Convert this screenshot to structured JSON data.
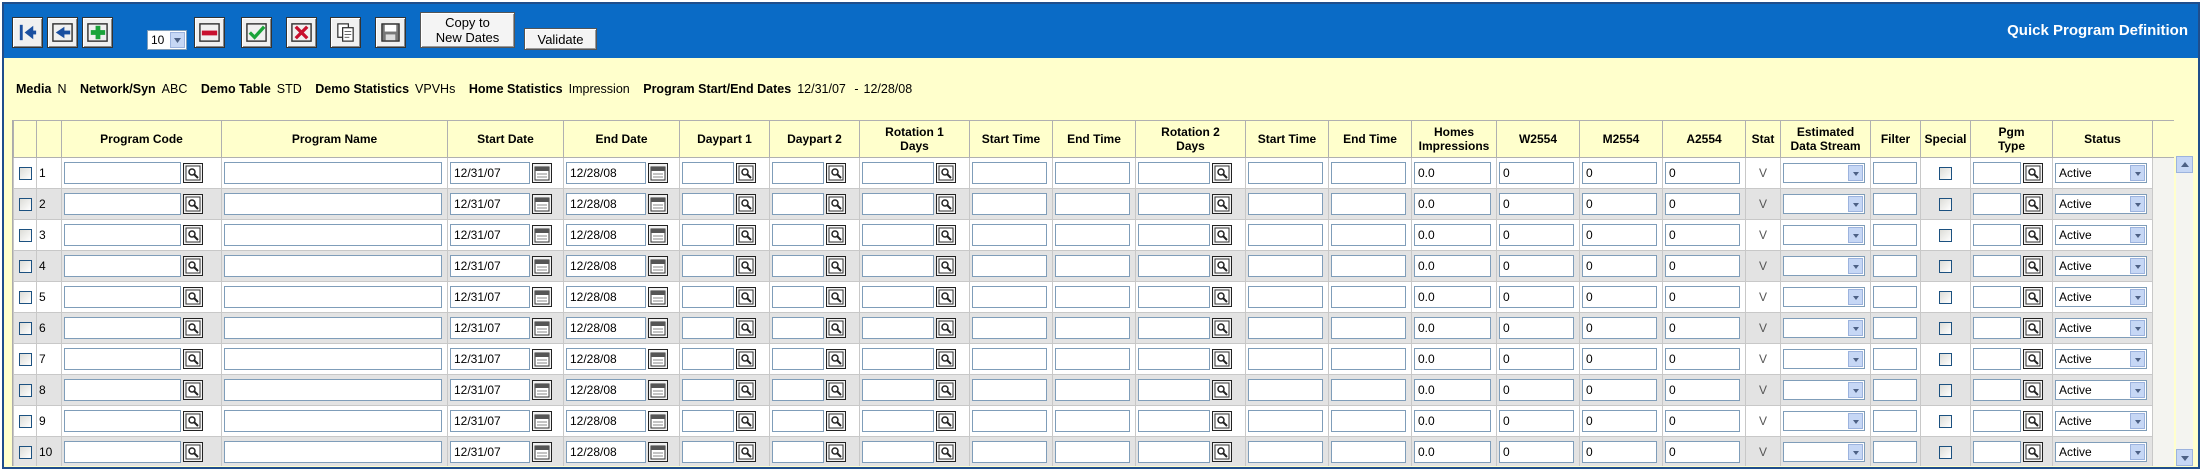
{
  "toolbar": {
    "rows_per_page": "10",
    "copy_dates_label_1": "Copy to",
    "copy_dates_label_2": "New Dates",
    "validate_label": "Validate",
    "app_title": "Quick Program Definition",
    "icons": [
      "first-icon",
      "back-icon",
      "add-icon",
      "remove-icon",
      "check-icon",
      "delete-icon",
      "copy-icon",
      "save-icon"
    ]
  },
  "info": {
    "media_label": "Media",
    "media_value": "N",
    "network_label": "Network/Syn",
    "network_value": "ABC",
    "demo_table_label": "Demo Table",
    "demo_table_value": "STD",
    "demo_stats_label": "Demo Statistics",
    "demo_stats_value": "VPVHs",
    "home_stats_label": "Home Statistics",
    "home_stats_value": "Impression",
    "dates_label": "Program Start/End Dates",
    "start_date": "12/31/07",
    "dash": "-",
    "end_date": "12/28/08"
  },
  "columns": {
    "program_code": "Program Code",
    "program_name": "Program Name",
    "start_date": "Start Date",
    "end_date": "End Date",
    "daypart1": "Daypart 1",
    "daypart2": "Daypart 2",
    "rotation1_a": "Rotation 1",
    "rotation1_b": "Days",
    "start_time1": "Start Time",
    "end_time1": "End Time",
    "rotation2_a": "Rotation 2",
    "rotation2_b": "Days",
    "start_time2": "Start Time",
    "end_time2": "End Time",
    "homes_a": "Homes",
    "homes_b": "Impressions",
    "w2554": "W2554",
    "m2554": "M2554",
    "a2554": "A2554",
    "stat": "Stat",
    "est_a": "Estimated",
    "est_b": "Data Stream",
    "filter": "Filter",
    "special": "Special",
    "pgm_a": "Pgm",
    "pgm_b": "Type",
    "status": "Status"
  },
  "rows": [
    {
      "n": "1",
      "start": "12/31/07",
      "end": "12/28/08",
      "homes": "0.0",
      "w": "0",
      "m": "0",
      "a": "0",
      "stat": "V",
      "status": "Active"
    },
    {
      "n": "2",
      "start": "12/31/07",
      "end": "12/28/08",
      "homes": "0.0",
      "w": "0",
      "m": "0",
      "a": "0",
      "stat": "V",
      "status": "Active"
    },
    {
      "n": "3",
      "start": "12/31/07",
      "end": "12/28/08",
      "homes": "0.0",
      "w": "0",
      "m": "0",
      "a": "0",
      "stat": "V",
      "status": "Active"
    },
    {
      "n": "4",
      "start": "12/31/07",
      "end": "12/28/08",
      "homes": "0.0",
      "w": "0",
      "m": "0",
      "a": "0",
      "stat": "V",
      "status": "Active"
    },
    {
      "n": "5",
      "start": "12/31/07",
      "end": "12/28/08",
      "homes": "0.0",
      "w": "0",
      "m": "0",
      "a": "0",
      "stat": "V",
      "status": "Active"
    },
    {
      "n": "6",
      "start": "12/31/07",
      "end": "12/28/08",
      "homes": "0.0",
      "w": "0",
      "m": "0",
      "a": "0",
      "stat": "V",
      "status": "Active"
    },
    {
      "n": "7",
      "start": "12/31/07",
      "end": "12/28/08",
      "homes": "0.0",
      "w": "0",
      "m": "0",
      "a": "0",
      "stat": "V",
      "status": "Active"
    },
    {
      "n": "8",
      "start": "12/31/07",
      "end": "12/28/08",
      "homes": "0.0",
      "w": "0",
      "m": "0",
      "a": "0",
      "stat": "V",
      "status": "Active"
    },
    {
      "n": "9",
      "start": "12/31/07",
      "end": "12/28/08",
      "homes": "0.0",
      "w": "0",
      "m": "0",
      "a": "0",
      "stat": "V",
      "status": "Active"
    },
    {
      "n": "10",
      "start": "12/31/07",
      "end": "12/28/08",
      "homes": "0.0",
      "w": "0",
      "m": "0",
      "a": "0",
      "stat": "V",
      "status": "Active"
    }
  ],
  "colors": {
    "toolbar_bg": "#0a6bc6",
    "page_bg": "#ffffcc",
    "row_alt": "#e3e3e3"
  }
}
